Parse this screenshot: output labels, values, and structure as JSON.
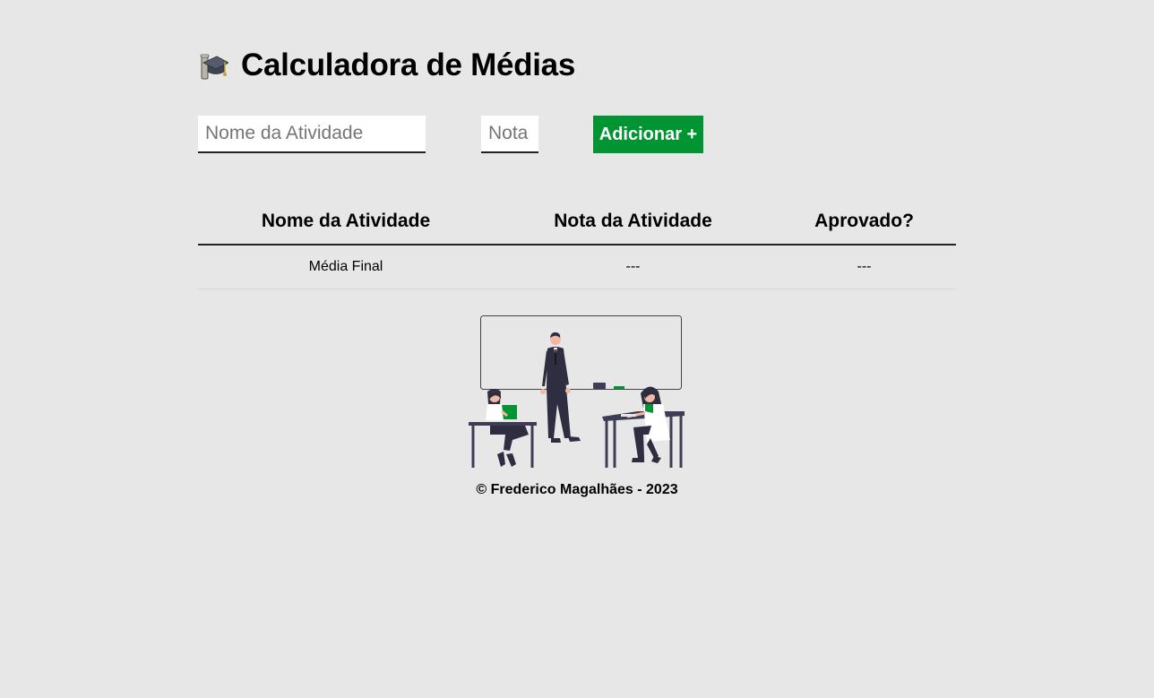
{
  "header": {
    "title": "Calculadora de Médias",
    "icon": "graduation-cap-icon"
  },
  "form": {
    "activity_name_placeholder": "Nome da Atividade",
    "activity_name_value": "",
    "grade_placeholder": "Nota",
    "grade_value": "",
    "add_button_label": "Adicionar +"
  },
  "table": {
    "headers": [
      "Nome da Atividade",
      "Nota da Atividade",
      "Aprovado?"
    ],
    "footer_row": {
      "label": "Média Final",
      "grade": "---",
      "approved": "---"
    }
  },
  "illustration": {
    "icon": "classroom-illustration"
  },
  "footer": {
    "text": "© Frederico Magalhães - 2023"
  },
  "colors": {
    "background": "#e7e7e7",
    "accent": "#009432",
    "text": "#000000"
  }
}
